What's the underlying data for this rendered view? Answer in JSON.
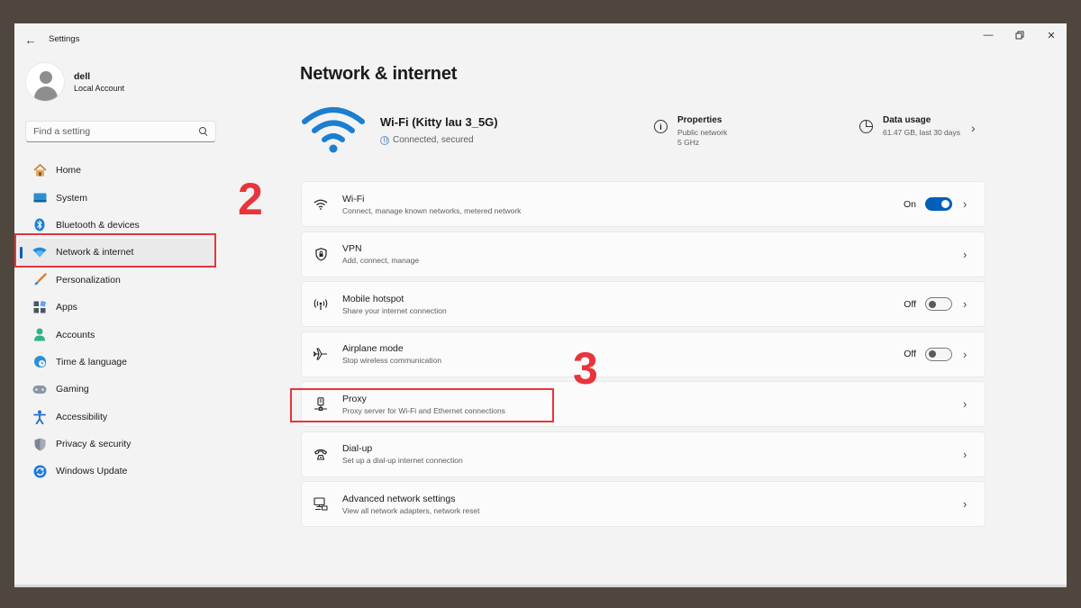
{
  "window": {
    "app_title": "Settings",
    "back_icon": "arrow-left-icon",
    "controls": [
      "minimize-icon",
      "restore-icon",
      "close-icon"
    ]
  },
  "profile": {
    "name": "dell",
    "account_type": "Local Account"
  },
  "search": {
    "placeholder": "Find a setting"
  },
  "sidebar": {
    "items": [
      {
        "label": "Home",
        "icon": "home-icon",
        "active": false
      },
      {
        "label": "System",
        "icon": "monitor-icon",
        "active": false
      },
      {
        "label": "Bluetooth & devices",
        "icon": "bluetooth-icon",
        "active": false
      },
      {
        "label": "Network & internet",
        "icon": "wifi-icon",
        "active": true
      },
      {
        "label": "Personalization",
        "icon": "brush-icon",
        "active": false
      },
      {
        "label": "Apps",
        "icon": "apps-icon",
        "active": false
      },
      {
        "label": "Accounts",
        "icon": "person-icon",
        "active": false
      },
      {
        "label": "Time & language",
        "icon": "globe-clock-icon",
        "active": false
      },
      {
        "label": "Gaming",
        "icon": "gamepad-icon",
        "active": false
      },
      {
        "label": "Accessibility",
        "icon": "accessibility-icon",
        "active": false
      },
      {
        "label": "Privacy & security",
        "icon": "shield-icon",
        "active": false
      },
      {
        "label": "Windows Update",
        "icon": "update-icon",
        "active": false
      }
    ]
  },
  "main": {
    "title": "Network & internet",
    "connection": {
      "name": "Wi-Fi (Kitty lau 3_5G)",
      "status": "Connected, secured"
    },
    "properties": {
      "title": "Properties",
      "line1": "Public network",
      "line2": "5 GHz"
    },
    "data_usage": {
      "title": "Data usage",
      "detail": "61.47 GB, last 30 days"
    },
    "cards": [
      {
        "title": "Wi-Fi",
        "subtitle": "Connect, manage known networks, metered network",
        "icon": "wifi-icon",
        "toggle": true,
        "toggle_label": "On"
      },
      {
        "title": "VPN",
        "subtitle": "Add, connect, manage",
        "icon": "vpn-shield-icon"
      },
      {
        "title": "Mobile hotspot",
        "subtitle": "Share your internet connection",
        "icon": "hotspot-icon",
        "toggle": false,
        "toggle_label": "Off"
      },
      {
        "title": "Airplane mode",
        "subtitle": "Stop wireless communication",
        "icon": "airplane-icon",
        "toggle": false,
        "toggle_label": "Off"
      },
      {
        "title": "Proxy",
        "subtitle": "Proxy server for Wi-Fi and Ethernet connections",
        "icon": "proxy-icon"
      },
      {
        "title": "Dial-up",
        "subtitle": "Set up a dial-up internet connection",
        "icon": "dialup-icon"
      },
      {
        "title": "Advanced network settings",
        "subtitle": "View all network adapters, network reset",
        "icon": "network-adapter-icon"
      }
    ]
  },
  "annotations": {
    "step2": "2",
    "step3": "3"
  },
  "colors": {
    "accent": "#005fb8",
    "highlight": "#e8343b",
    "background": "#f3f3f3"
  }
}
